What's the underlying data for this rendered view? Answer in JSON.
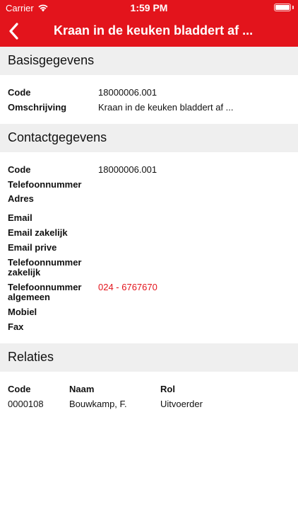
{
  "statusbar": {
    "carrier": "Carrier",
    "time": "1:59 PM",
    "wifi_icon": "wifi-icon",
    "battery_icon": "battery-icon"
  },
  "navbar": {
    "back_icon": "chevron-left-icon",
    "title": "Kraan in de keuken bladdert af  ...",
    "color": "#e3141c"
  },
  "basisgegevens": {
    "title": "Basisgegevens",
    "code_label": "Code",
    "code_value": "18000006.001",
    "omschrijving_label": "Omschrijving",
    "omschrijving_value": "Kraan in de keuken bladdert af  ..."
  },
  "contactgegevens": {
    "title": "Contactgegevens",
    "code_label": "Code",
    "code_value": "18000006.001",
    "telefoon_label": "Telefoonnummer",
    "adres_label": "Adres",
    "email_label": "Email",
    "email_zakelijk_label": "Email zakelijk",
    "email_prive_label": "Email prive",
    "tel_zakelijk_label_1": "Telefoonnummer",
    "tel_zakelijk_label_2": "zakelijk",
    "tel_algemeen_label_1": "Telefoonnummer",
    "tel_algemeen_label_2": "algemeen",
    "tel_algemeen_value": "024 - 6767670",
    "mobiel_label": "Mobiel",
    "fax_label": "Fax"
  },
  "relaties": {
    "title": "Relaties",
    "columns": [
      "Code",
      "Naam",
      "Rol"
    ],
    "rows": [
      [
        "0000108",
        "Bouwkamp, F.",
        "Uitvoerder"
      ]
    ]
  }
}
